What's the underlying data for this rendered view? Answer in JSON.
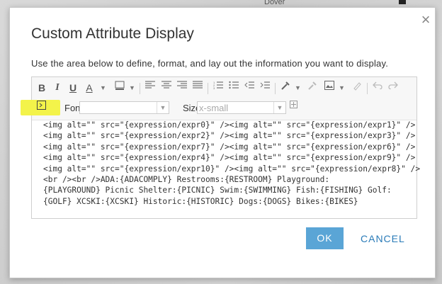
{
  "map": {
    "place_label": "Dover"
  },
  "dialog": {
    "title": "Custom Attribute Display",
    "instructions": "Use the area below to define, format, and lay out the information you want to display.",
    "close_icon": "close-icon"
  },
  "toolbar": {
    "bold": "B",
    "italic": "I",
    "underline": "U",
    "text_color": "A",
    "font_label": "Font",
    "font_value": "",
    "size_label": "Size",
    "size_value": "x-small",
    "icons": [
      "bold-icon",
      "italic-icon",
      "underline-icon",
      "text-color-icon",
      "highlight-color-icon",
      "align-left-icon",
      "align-center-icon",
      "align-right-icon",
      "justify-icon",
      "numbered-list-icon",
      "bulleted-list-icon",
      "indent-icon",
      "outdent-icon",
      "insert-link-icon",
      "unlink-icon",
      "insert-image-icon",
      "remove-format-icon",
      "undo-icon",
      "redo-icon",
      "source-icon",
      "expand-icon"
    ]
  },
  "content": {
    "lines": [
      "<img alt=\"\" src=\"{expression/expr0}\" /><img alt=\"\" src=\"{expression/expr1}\" />",
      "<img alt=\"\" src=\"{expression/expr2}\" /><img alt=\"\" src=\"{expression/expr3}\" />",
      "<img alt=\"\" src=\"{expression/expr7}\" /><img alt=\"\" src=\"{expression/expr6}\" />",
      "<img alt=\"\" src=\"{expression/expr4}\" /><img alt=\"\" src=\"{expression/expr9}\" />",
      "<img alt=\"\" src=\"{expression/expr10}\" /><img alt=\"\" src=\"{expression/expr8}\" />",
      "<br /><br />ADA:{ADACOMPLY} Restrooms:{RESTROOM} Playground:",
      "{PLAYGROUND} Picnic Shelter:{PICNIC} Swim:{SWIMMING} Fish:{FISHING} Golf:",
      "{GOLF} XCSKI:{XCSKI} Historic:{HISTORIC} Dogs:{DOGS} Bikes:{BIKES}"
    ]
  },
  "buttons": {
    "ok": "OK",
    "cancel": "CANCEL"
  },
  "colors": {
    "primary": "#5aa5d6",
    "link": "#2a7bb8",
    "highlight": "#f3f34a"
  }
}
